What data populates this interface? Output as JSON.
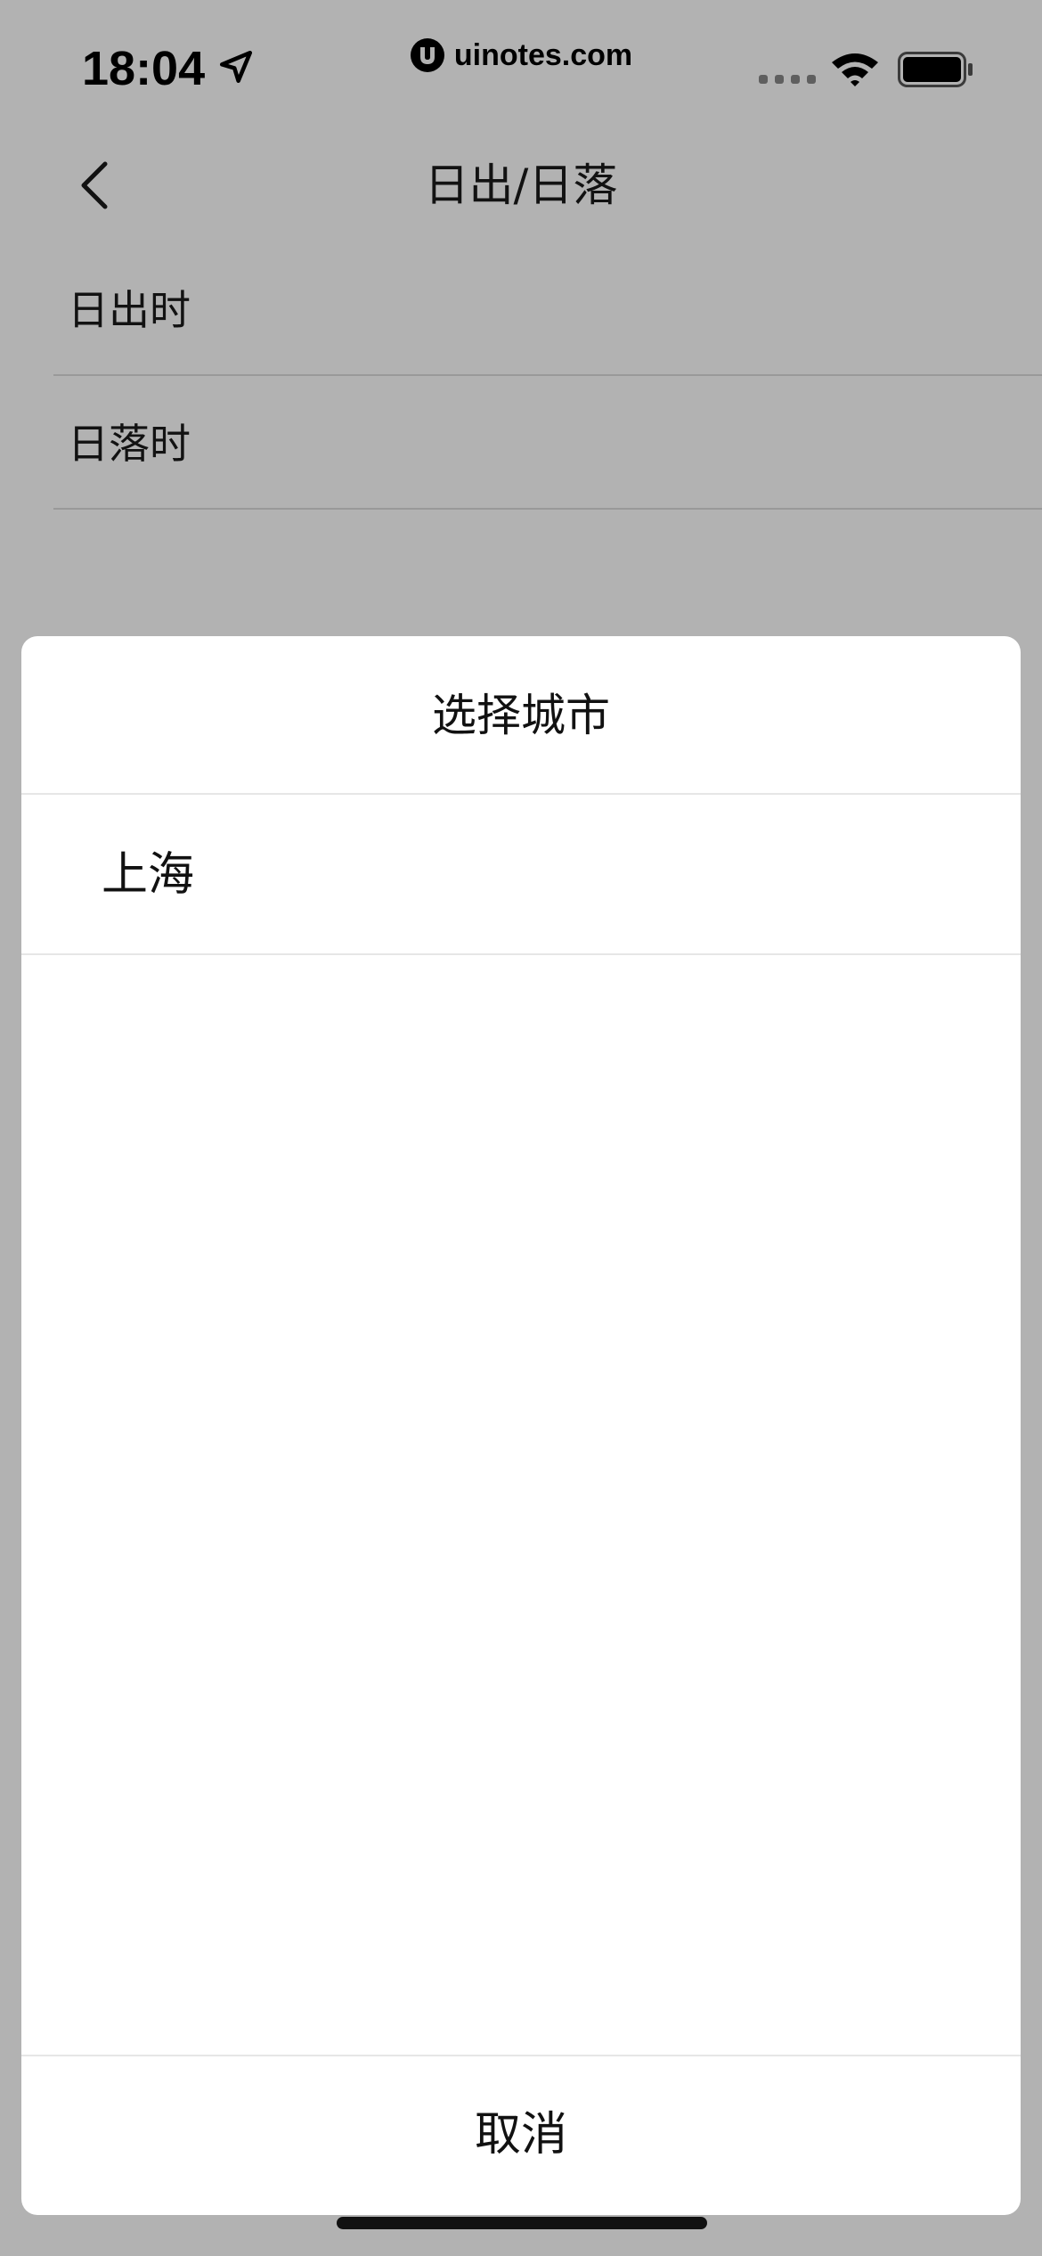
{
  "status_bar": {
    "time": "18:04",
    "watermark": "uinotes.com",
    "icons": [
      "location-arrow-icon",
      "uinotes-logo-icon",
      "cellular-signal-icon",
      "wifi-icon",
      "battery-icon"
    ]
  },
  "nav": {
    "title": "日出/日落",
    "back_icon": "chevron-left-icon"
  },
  "settings": {
    "rows": [
      {
        "label": "日出时"
      },
      {
        "label": "日落时"
      }
    ]
  },
  "sheet": {
    "title": "选择城市",
    "cities": [
      {
        "label": "上海"
      }
    ],
    "cancel_label": "取消"
  },
  "colors": {
    "overlay": "#000000",
    "sheet_background": "#ffffff",
    "divider": "#e6e6e6",
    "text": "#111111"
  }
}
